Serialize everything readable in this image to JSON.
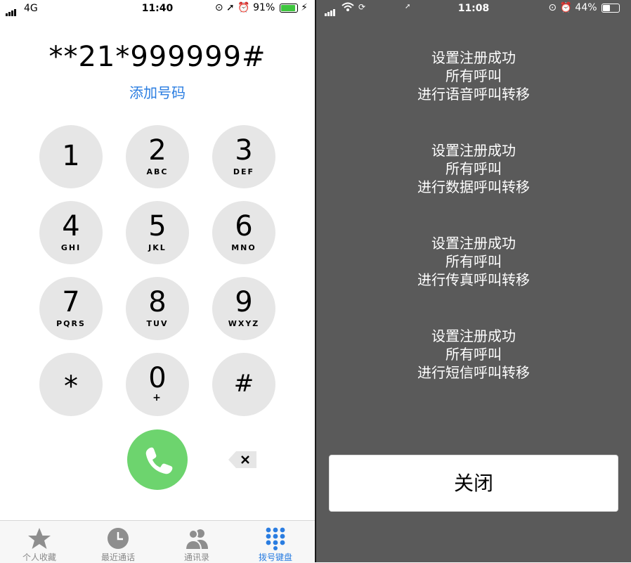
{
  "left_screen": {
    "status": {
      "carrier": "4G",
      "time": "11:40",
      "battery": "91%",
      "battery_level": 0.91,
      "icons": [
        "orientation-lock-icon",
        "location-arrow-icon",
        "alarm-icon",
        "charging-icon"
      ]
    },
    "dialed_number": "**21*999999#",
    "add_number_label": "添加号码",
    "keys": [
      {
        "digit": "1",
        "letters": ""
      },
      {
        "digit": "2",
        "letters": "ABC"
      },
      {
        "digit": "3",
        "letters": "DEF"
      },
      {
        "digit": "4",
        "letters": "GHI"
      },
      {
        "digit": "5",
        "letters": "JKL"
      },
      {
        "digit": "6",
        "letters": "MNO"
      },
      {
        "digit": "7",
        "letters": "PQRS"
      },
      {
        "digit": "8",
        "letters": "TUV"
      },
      {
        "digit": "9",
        "letters": "WXYZ"
      },
      {
        "digit": "*",
        "letters": ""
      },
      {
        "digit": "0",
        "letters": "+"
      },
      {
        "digit": "#",
        "letters": ""
      }
    ],
    "tabs": [
      {
        "label": "个人收藏",
        "icon": "star-icon"
      },
      {
        "label": "最近通话",
        "icon": "clock-icon"
      },
      {
        "label": "通讯录",
        "icon": "contacts-icon"
      },
      {
        "label": "拨号键盘",
        "icon": "keypad-icon",
        "active": true
      }
    ],
    "colors": {
      "accent": "#2a7de1",
      "call": "#6dd46e",
      "key": "#e6e6e6"
    }
  },
  "right_screen": {
    "status": {
      "time": "11:08",
      "battery": "44%",
      "battery_level": 0.44,
      "icons": [
        "wifi-icon",
        "loading-icon",
        "orientation-lock-icon",
        "alarm-icon"
      ]
    },
    "messages": [
      {
        "line1": "设置注册成功",
        "line2": "所有呼叫",
        "line3": "进行语音呼叫转移"
      },
      {
        "line1": "设置注册成功",
        "line2": "所有呼叫",
        "line3": "进行数据呼叫转移"
      },
      {
        "line1": "设置注册成功",
        "line2": "所有呼叫",
        "line3": "进行传真呼叫转移"
      },
      {
        "line1": "设置注册成功",
        "line2": "所有呼叫",
        "line3": "进行短信呼叫转移"
      }
    ],
    "close_label": "关闭",
    "colors": {
      "background": "#5a5a5a"
    }
  }
}
